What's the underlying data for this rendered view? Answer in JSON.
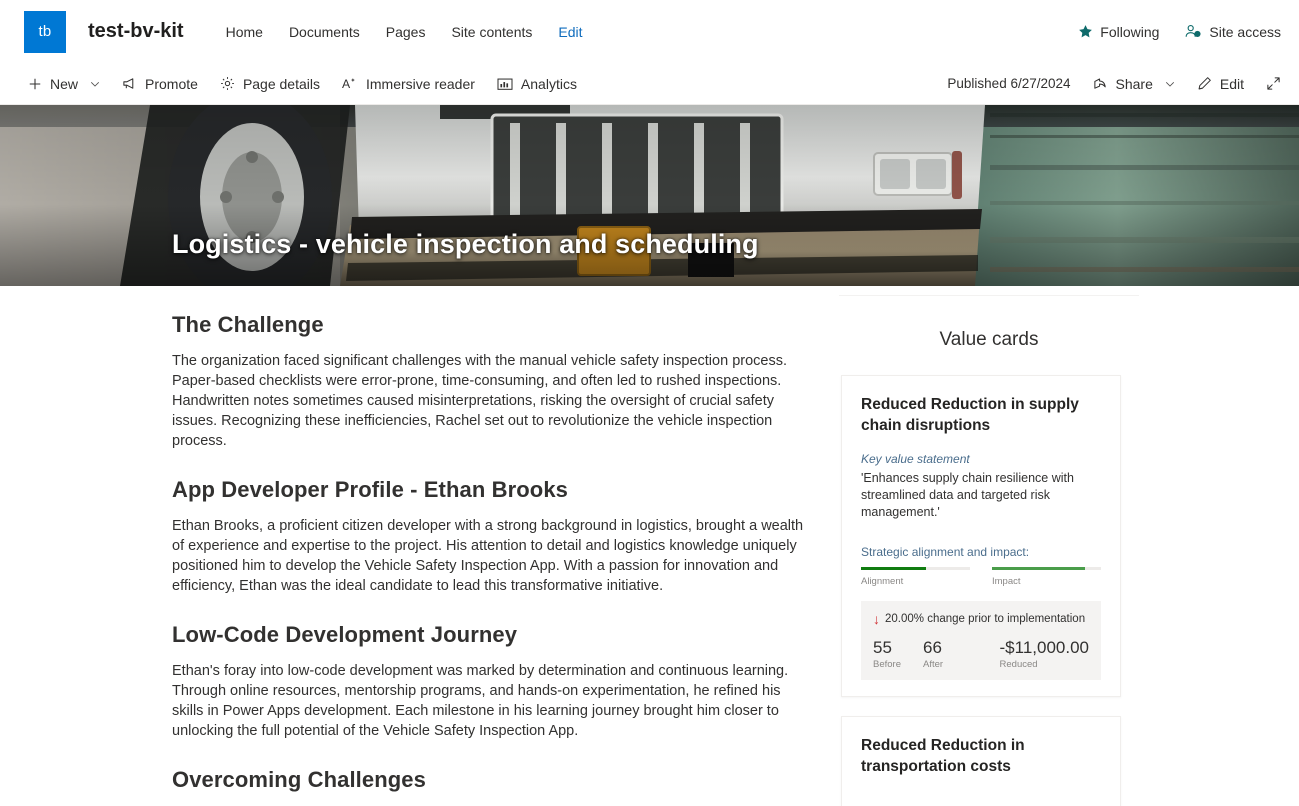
{
  "suite": {
    "logo_text": "tb",
    "site_title": "test-bv-kit",
    "nav": [
      {
        "label": "Home",
        "name": "nav-home"
      },
      {
        "label": "Documents",
        "name": "nav-documents"
      },
      {
        "label": "Pages",
        "name": "nav-pages"
      },
      {
        "label": "Site contents",
        "name": "nav-site-contents"
      },
      {
        "label": "Edit",
        "name": "nav-edit"
      }
    ],
    "following_label": "Following",
    "site_access_label": "Site access"
  },
  "command_bar": {
    "new_label": "New",
    "promote_label": "Promote",
    "page_details_label": "Page details",
    "immersive_reader_label": "Immersive reader",
    "analytics_label": "Analytics",
    "published_label": "Published 6/27/2024",
    "share_label": "Share",
    "edit_label": "Edit"
  },
  "hero": {
    "title": "Logistics - vehicle inspection and scheduling"
  },
  "main": {
    "sections": [
      {
        "heading": "The Challenge",
        "body": "The organization faced significant challenges with the manual vehicle safety inspection process. Paper-based checklists were error-prone, time-consuming, and often led to rushed inspections. Handwritten notes sometimes caused misinterpretations, risking the oversight of crucial safety issues. Recognizing these inefficiencies, Rachel set out to revolutionize the vehicle inspection process."
      },
      {
        "heading": "App Developer Profile - Ethan Brooks",
        "body": "Ethan Brooks, a proficient citizen developer with a strong background in logistics, brought a wealth of experience and expertise to the project. His attention to detail and logistics knowledge uniquely positioned him to develop the Vehicle Safety Inspection App. With a passion for innovation and efficiency, Ethan was the ideal candidate to lead this transformative initiative."
      },
      {
        "heading": "Low-Code Development Journey",
        "body": "Ethan's foray into low-code development was marked by determination and continuous learning. Through online resources, mentorship programs, and hands-on experimentation, he refined his skills in Power Apps development. Each milestone in his learning journey brought him closer to unlocking the full potential of the Vehicle Safety Inspection App."
      },
      {
        "heading": "Overcoming Challenges",
        "body": ""
      }
    ]
  },
  "sidebar": {
    "heading": "Value cards",
    "cards": [
      {
        "title": "Reduced Reduction in supply chain disruptions",
        "key_value_label": "Key value statement",
        "key_value_text": "'Enhances supply chain resilience with streamlined data and targeted risk management.'",
        "strategic_label": "Strategic alignment and impact:",
        "bars": [
          {
            "name": "Alignment",
            "percent": 60,
            "color": "#107c10"
          },
          {
            "name": "Impact",
            "percent": 85,
            "color": "#4a9d4a"
          }
        ],
        "change_text": "20.00% change prior to implementation",
        "change_direction": "down",
        "change_color": "#d13438",
        "metrics": [
          {
            "value": "55",
            "caption": "Before"
          },
          {
            "value": "66",
            "caption": "After"
          },
          {
            "value": "-$11,000.00",
            "caption": "Reduced"
          }
        ]
      },
      {
        "title": "Reduced Reduction in transportation costs"
      }
    ]
  },
  "colors": {
    "accent_blue": "#0078d4",
    "link_blue": "#0f6cbd",
    "teal": "#0f6b6b",
    "green_dark": "#107c10",
    "green_light": "#4a9d4a",
    "red": "#d13438"
  }
}
